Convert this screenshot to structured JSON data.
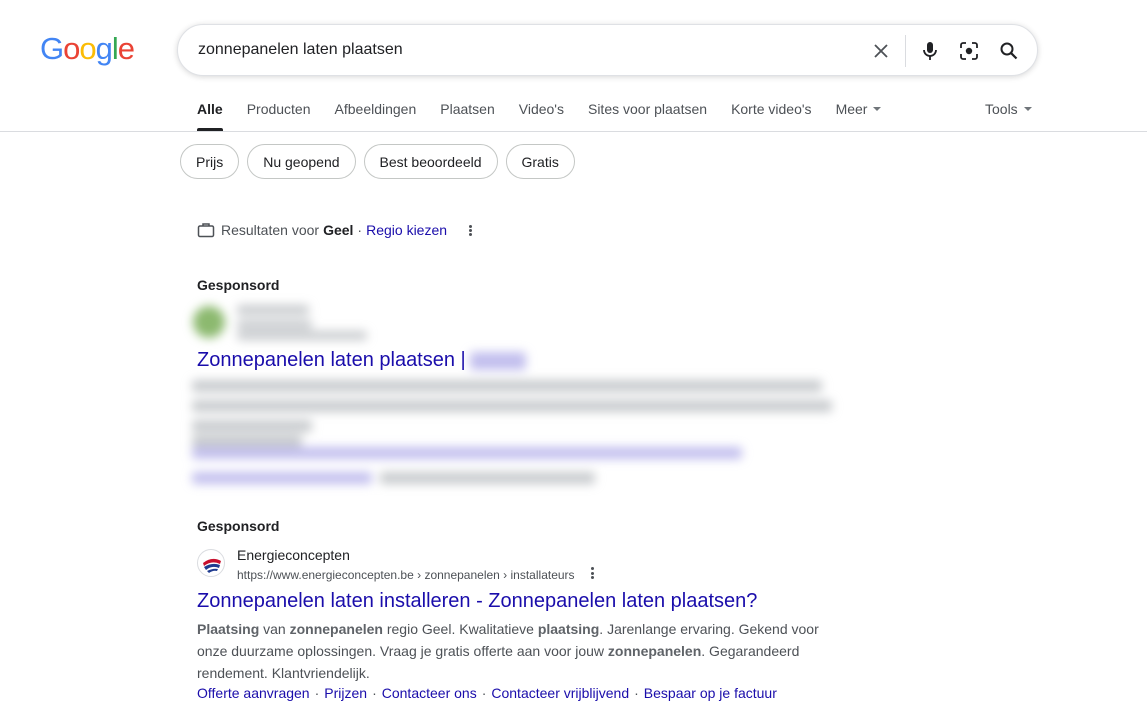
{
  "logo": {
    "letters": [
      "G",
      "o",
      "o",
      "g",
      "l",
      "e"
    ],
    "colors": [
      "#4285f4",
      "#ea4335",
      "#fbbc05",
      "#4285f4",
      "#34a853",
      "#ea4335"
    ]
  },
  "search": {
    "query": "zonnepanelen laten plaatsen"
  },
  "tabs": [
    {
      "label": "Alle",
      "active": true
    },
    {
      "label": "Producten"
    },
    {
      "label": "Afbeeldingen"
    },
    {
      "label": "Plaatsen"
    },
    {
      "label": "Video's"
    },
    {
      "label": "Sites voor plaatsen"
    },
    {
      "label": "Korte video's"
    },
    {
      "label": "Meer"
    }
  ],
  "tools_label": "Tools",
  "chips": [
    "Prijs",
    "Nu geopend",
    "Best beoordeeld",
    "Gratis"
  ],
  "region": {
    "prefix": "Resultaten voor",
    "place": "Geel",
    "separator": "·",
    "link": "Regio kiezen"
  },
  "ad1": {
    "sponsored_label": "Gesponsord",
    "title": "Zonnepanelen laten plaatsen |"
  },
  "ad2": {
    "sponsored_label": "Gesponsord",
    "site_name": "Energieconcepten",
    "url": "https://www.energieconcepten.be › zonnepanelen › installateurs",
    "title": "Zonnepanelen laten installeren - Zonnepanelen laten plaatsen?",
    "snippet": [
      {
        "t": "Plaatsing",
        "b": true
      },
      {
        "t": " van "
      },
      {
        "t": "zonnepanelen",
        "b": true
      },
      {
        "t": " regio Geel. Kwalitatieve "
      },
      {
        "t": "plaatsing",
        "b": true
      },
      {
        "t": ". Jarenlange ervaring. Gekend voor onze duurzame oplossingen. Vraag je gratis offerte aan voor jouw "
      },
      {
        "t": "zonnepanelen",
        "b": true
      },
      {
        "t": ". Gegarandeerd rendement. Klantvriendelijk."
      }
    ],
    "sitelinks": [
      "Offerte aanvragen",
      "Prijzen",
      "Contacteer ons",
      "Contacteer vrijblijvend",
      "Bespaar op je factuur"
    ],
    "sitelink_separator": "·"
  },
  "colors": {
    "link": "#1a0dab",
    "text": "#202124",
    "muted": "#4d5156"
  }
}
